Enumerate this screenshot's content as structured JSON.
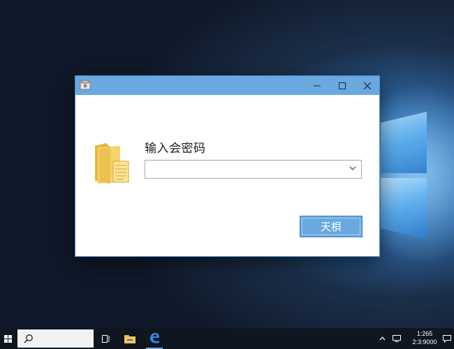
{
  "dialog": {
    "title": "",
    "prompt_label": "输入会密码",
    "password_combo": {
      "value": "",
      "placeholder": ""
    },
    "ok_button_label": "天梖"
  },
  "taskbar": {
    "clock_time": "1:265",
    "clock_date": "2:3:9000"
  },
  "icons": {
    "app": "app-icon",
    "folder": "folder-document-icon",
    "minimize": "minimize-icon",
    "maximize": "maximize-icon",
    "close": "close-icon",
    "combo_arrow": "chevron-down-icon",
    "start": "windows-start-icon",
    "search": "search-icon",
    "task_view": "task-view-icon",
    "explorer": "file-explorer-icon",
    "edge": "edge-icon",
    "tray_chevron": "chevron-up-icon",
    "network": "network-icon",
    "notifications": "notification-icon"
  },
  "colors": {
    "accent": "#6aa8e0",
    "ok_button_border": "#3d7fc2",
    "taskbar": "#0f1620"
  }
}
